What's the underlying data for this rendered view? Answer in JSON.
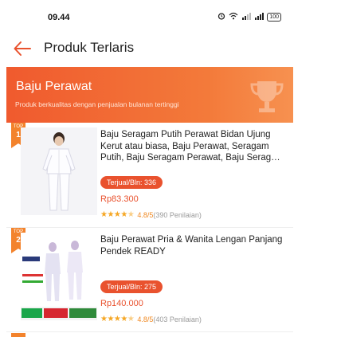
{
  "status_bar": {
    "time": "09.44",
    "battery": "100"
  },
  "header": {
    "title": "Produk Terlaris"
  },
  "banner": {
    "title": "Baju Perawat",
    "subtitle": "Produk berkualitas dengan penjualan bulanan tertinggi"
  },
  "colors": {
    "accent": "#e9522e",
    "banner": "#f05a2e",
    "star": "#f5a623"
  },
  "products": [
    {
      "rank_label": "TOP",
      "rank": "1",
      "name": "Baju Seragam Putih Perawat Bidan Ujung Kerut atau biasa, Baju Perawat, Seragam Putih, Baju Seragam Perawat, Baju Serag…",
      "sold": "Terjual/Bln: 336",
      "price": "Rp83.300",
      "rating": "4.8/5",
      "reviews": "(390 Penilaian)"
    },
    {
      "rank_label": "TOP",
      "rank": "2",
      "name": "Baju Perawat Pria & Wanita Lengan Panjang  Pendek READY",
      "sold": "Terjual/Bln: 275",
      "price": "Rp140.000",
      "rating": "4.8/5",
      "reviews": "(403 Penilaian)"
    }
  ]
}
